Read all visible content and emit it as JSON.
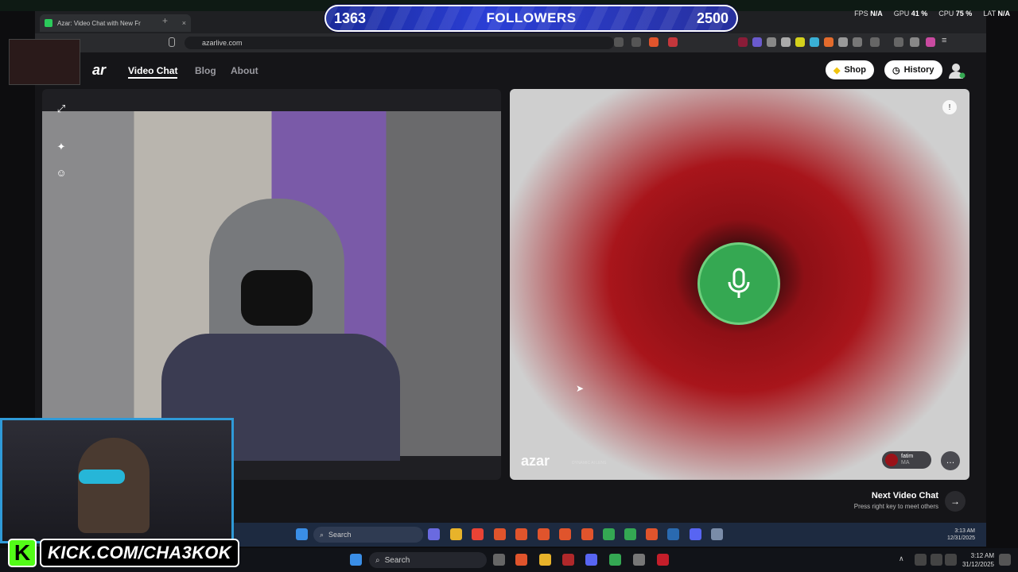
{
  "browser": {
    "tab_title": "Azar: Video Chat with New Fr",
    "tab_close": "×",
    "new_tab": "+",
    "url": "azarlive.com"
  },
  "overlay": {
    "followers_current": "1363",
    "followers_label": "FOLLOWERS",
    "followers_goal": "2500",
    "kick_k": "K",
    "kick_channel": "KICK.COM/CHA3KOK"
  },
  "stats": {
    "fps_label": "FPS",
    "fps_value": "N/A",
    "gpu_label": "GPU",
    "gpu_value": "41 %",
    "cpu_label": "CPU",
    "cpu_value": "75 %",
    "lat_label": "LAT",
    "lat_value": "N/A"
  },
  "site": {
    "logo_fragment": "ar",
    "nav": {
      "video_chat": "Video Chat",
      "blog": "Blog",
      "about": "About"
    },
    "shop_label": "Shop",
    "history_label": "History"
  },
  "remote": {
    "brand": "azar",
    "brand_sub": "DYNAMIC AI LENS",
    "user_name": "fatim",
    "user_country": "MA"
  },
  "next_chat": {
    "title": "Next Video Chat",
    "subtitle": "Press right key to meet others",
    "arrow": "→"
  },
  "taskbar_inner": {
    "search": "Search",
    "time": "3:13 AM",
    "date": "12/31/2025"
  },
  "taskbar_outer": {
    "search": "Search",
    "time": "3:12 AM",
    "date": "31/12/2025"
  },
  "colors": {
    "accent_green": "#35a852",
    "kick_green": "#53fc18",
    "followers_blue": "#2b3fd6"
  }
}
